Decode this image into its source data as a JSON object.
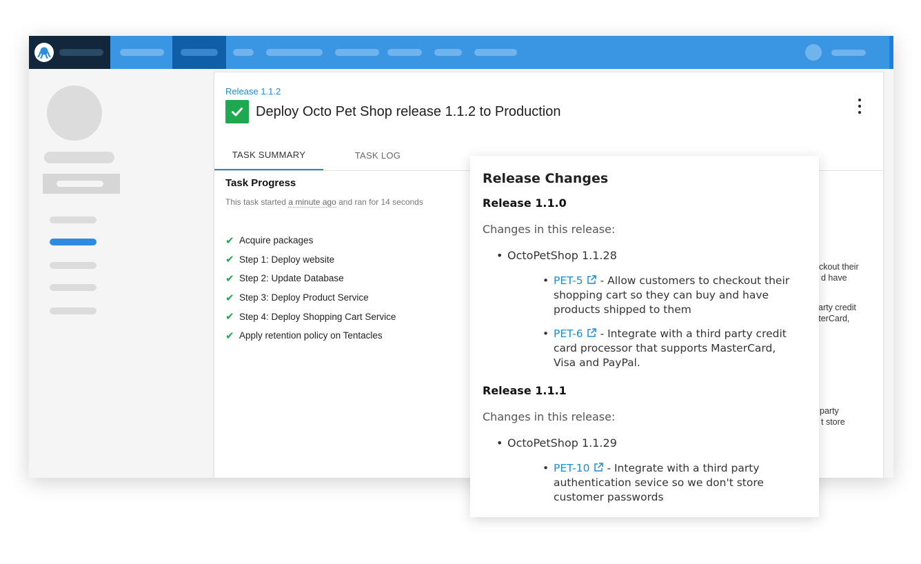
{
  "release_link": "Release 1.1.2",
  "page_title": "Deploy Octo Pet Shop release 1.1.2 to Production",
  "tabs": [
    "TASK SUMMARY",
    "TASK LOG"
  ],
  "task_progress": {
    "title": "Task Progress",
    "started_prefix": "This task started",
    "started_relative": "a minute ago",
    "duration_text": "and ran for 14 seconds",
    "steps": [
      "Acquire packages",
      "Step 1: Deploy website",
      "Step 2: Update Database",
      "Step 3: Deploy Product Service",
      "Step 4: Deploy Shopping Cart Service",
      "Apply retention policy on Tentacles"
    ]
  },
  "background_fragments": [
    "eckout their",
    "d have",
    "arty credit",
    "sterCard,",
    "party",
    "t store"
  ],
  "release_changes": {
    "heading": "Release Changes",
    "releases": [
      {
        "name": "Release 1.1.0",
        "changes_label": "Changes in this release:",
        "package": "OctoPetShop 1.1.28",
        "items": [
          {
            "ticket": "PET-5",
            "text_lines": [
              "- Allow customers to checkout their",
              "shopping cart so they can buy and have",
              "products shipped to them"
            ]
          },
          {
            "ticket": "PET-6",
            "text_lines": [
              "- Integrate with a third party credit",
              "card processor that supports MasterCard,",
              "Visa and PayPal."
            ]
          }
        ]
      },
      {
        "name": "Release 1.1.1",
        "changes_label": "Changes in this release:",
        "package": "OctoPetShop 1.1.29",
        "items": [
          {
            "ticket": "PET-10",
            "text_lines": [
              "- Integrate with a third party",
              "authentication sevice so we don't store",
              "customer passwords"
            ]
          }
        ]
      }
    ]
  },
  "colors": {
    "topbar": "#3a95e2",
    "brand_bg": "#12273b",
    "nav_active": "#0f5fa6",
    "link": "#1b8ad8",
    "success": "#1fa84f"
  },
  "icons": [
    "octopus-logo-icon",
    "checkmark-icon",
    "more-vert-icon",
    "external-link-icon"
  ]
}
